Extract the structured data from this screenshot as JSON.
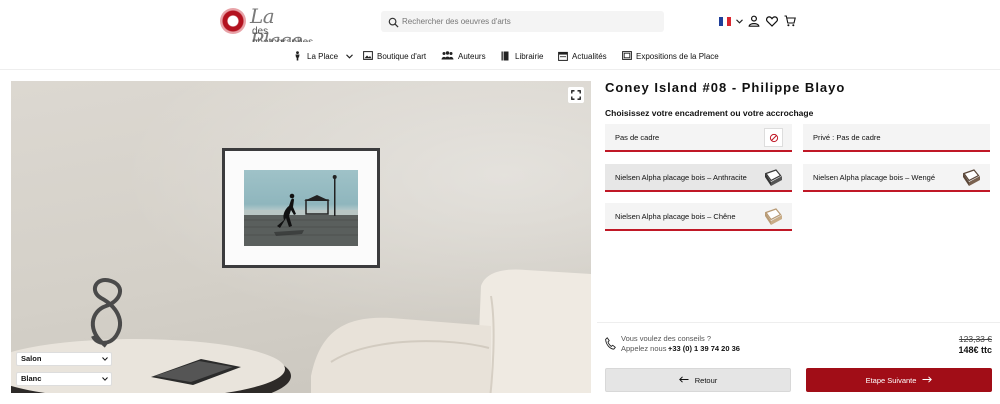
{
  "header": {
    "logo_script": "La Place",
    "logo_sub": "des photographes",
    "search_placeholder": "Rechercher des oeuvres d'arts",
    "colors": {
      "brand": "#b3121f"
    }
  },
  "nav": {
    "items": [
      {
        "label": "La Place",
        "icon": "person-icon"
      },
      {
        "label": "Boutique d'art",
        "icon": "image-icon"
      },
      {
        "label": "Auteurs",
        "icon": "group-icon"
      },
      {
        "label": "Librairie",
        "icon": "book-icon"
      },
      {
        "label": "Actualités",
        "icon": "calendar-icon"
      },
      {
        "label": "Expositions de la Place",
        "icon": "frame-icon"
      }
    ]
  },
  "mockup": {
    "room_select": "Salon",
    "wall_select": "Blanc"
  },
  "product": {
    "title": "Coney Island #08 - Philippe Blayo",
    "section_title": "Choisissez votre encadrement ou votre accrochage",
    "options": [
      {
        "label": "Pas de cadre",
        "selected": false
      },
      {
        "label": "Privé : Pas de cadre",
        "selected": false
      },
      {
        "label": "Nielsen Alpha placage bois – Anthracite",
        "selected": true
      },
      {
        "label": "Nielsen Alpha placage bois – Wengé",
        "selected": false
      },
      {
        "label": "Nielsen Alpha placage bois – Chêne",
        "selected": false
      }
    ]
  },
  "advice": {
    "line1": "Vous voulez des conseils ?",
    "line2_prefix": "Appelez nous :",
    "phone": "+33 (0) 1 39 74 20 36"
  },
  "price": {
    "old": "123,33 €",
    "new": "148€ ttc"
  },
  "buttons": {
    "back": "Retour",
    "next": "Etape Suivante"
  },
  "colors": {
    "accent": "#a10d17",
    "underline": "#c01826"
  }
}
